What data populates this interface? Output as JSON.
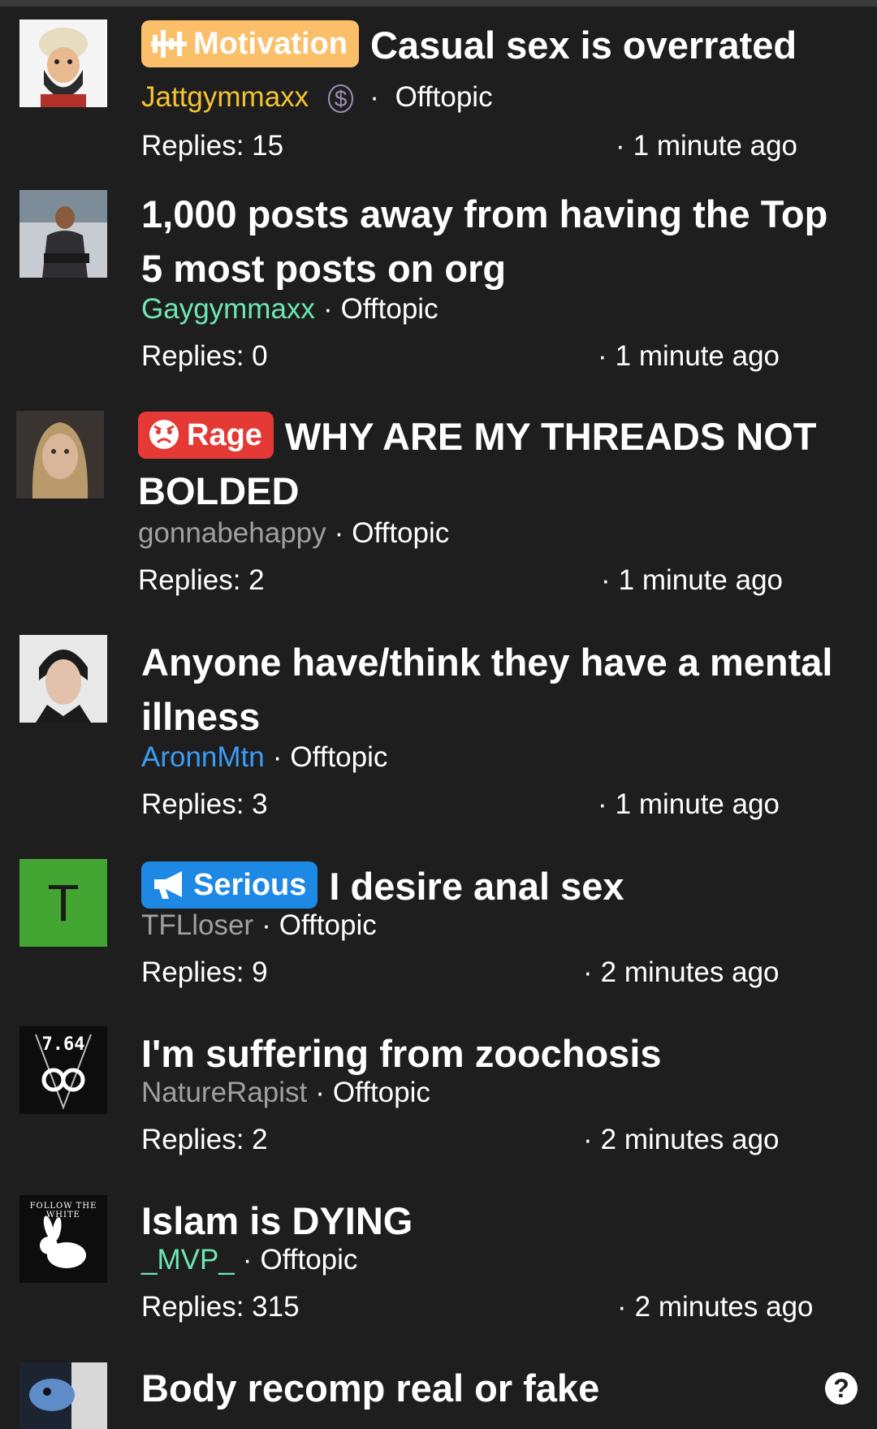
{
  "threads": [
    {
      "tag": {
        "label": "Motivation",
        "color": "#fbbf6a",
        "icon": "equalizer-icon"
      },
      "title": "Casual sex is overrated",
      "author": "Jattgymmaxx",
      "author_color": "#f4c430",
      "author_badge": "$",
      "forum": "Offtopic",
      "replies": "Replies: 15",
      "time": "1 minute ago"
    },
    {
      "title": "1,000 posts away from having the Top 5 most posts on org",
      "author": "Gaygymmaxx",
      "author_color": "#6ee7b7",
      "forum": "Offtopic",
      "replies": "Replies: 0",
      "time": "1 minute ago"
    },
    {
      "tag": {
        "label": "Rage",
        "color": "#e53935",
        "icon": "angry-face-icon"
      },
      "title": "WHY ARE MY THREADS NOT BOLDED",
      "author": "gonnabehappy",
      "author_color": "#a0a0a0",
      "forum": "Offtopic",
      "replies": "Replies: 2",
      "time": "1 minute ago"
    },
    {
      "title": "Anyone have/think they have a mental illness",
      "author": "AronnMtn",
      "author_color": "#3b9cf5",
      "forum": "Offtopic",
      "replies": "Replies: 3",
      "time": "1 minute ago"
    },
    {
      "tag": {
        "label": "Serious",
        "color": "#1e88e5",
        "icon": "megaphone-icon"
      },
      "title": "I desire anal sex",
      "author": "TFLloser",
      "author_color": "#a0a0a0",
      "forum": "Offtopic",
      "replies": "Replies: 9",
      "time": "2 minutes ago",
      "avatar_letter": "T"
    },
    {
      "title": "I'm suffering from zoochosis",
      "author": "NatureRapist",
      "author_color": "#a0a0a0",
      "forum": "Offtopic",
      "replies": "Replies: 2",
      "time": "2 minutes ago",
      "avatar_text": "7.64"
    },
    {
      "title": "Islam is DYING",
      "author": "_MVP_",
      "author_color": "#6ee7b7",
      "forum": "Offtopic",
      "replies": "Replies: 315",
      "time": "2 minutes ago",
      "avatar_text": "FOLLOW THE WHITE"
    },
    {
      "title": "Body recomp real or fake"
    }
  ],
  "help_label": "?",
  "separator": "·"
}
